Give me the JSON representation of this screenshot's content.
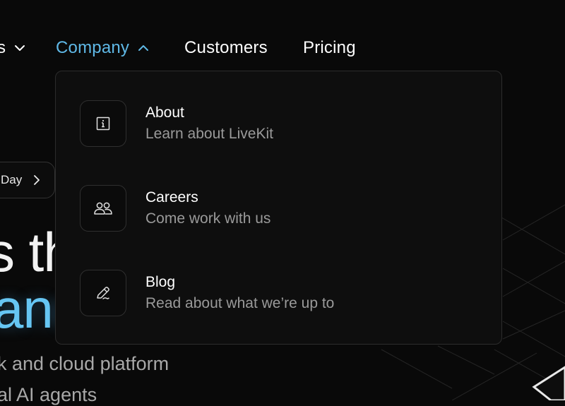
{
  "nav": {
    "partial_label": "s",
    "items": [
      {
        "label": "Company"
      },
      {
        "label": "Customers"
      },
      {
        "label": "Pricing"
      }
    ]
  },
  "dropdown": {
    "items": [
      {
        "title": "About",
        "description": "Learn about LiveKit",
        "icon": "info-icon"
      },
      {
        "title": "Careers",
        "description": "Come work with us",
        "icon": "people-icon"
      },
      {
        "title": "Blog",
        "description": "Read about what we’re up to",
        "icon": "pencil-icon"
      }
    ]
  },
  "hero": {
    "pill_text": "Day",
    "line1": "s th",
    "line2": "anc",
    "sub1": "k and cloud platform",
    "sub2": "al AI agents"
  },
  "colors": {
    "background": "#090909",
    "accent": "#5fb8e6",
    "muted_text": "#9a9a9a"
  }
}
